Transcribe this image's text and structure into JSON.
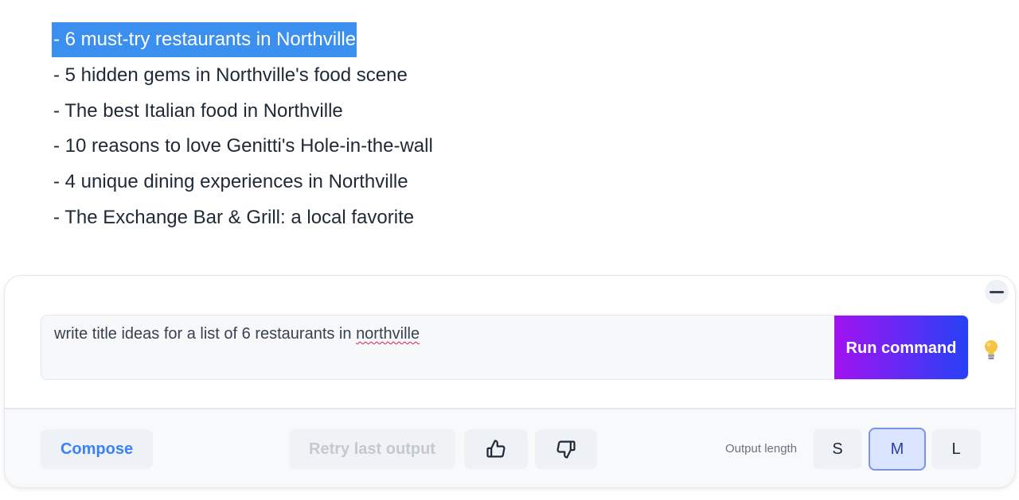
{
  "output": {
    "lines": [
      "- 6 must-try restaurants in Northville",
      "- 5 hidden gems in Northville's food scene",
      "- The best Italian food in Northville",
      "- 10 reasons to love Genitti's Hole-in-the-wall",
      "- 4 unique dining experiences in Northville",
      "- The Exchange Bar & Grill: a local favorite"
    ]
  },
  "command": {
    "prompt_before": "write title ideas for a list of 6 restaurants in ",
    "prompt_misspelled": "northville",
    "run_label": "Run command",
    "hint_icon": "lightbulb-icon"
  },
  "footer": {
    "compose_label": "Compose",
    "retry_label": "Retry last output",
    "thumbs_up_icon": "thumbs-up-icon",
    "thumbs_down_icon": "thumbs-down-icon",
    "output_length_label": "Output length",
    "sizes": [
      "S",
      "M",
      "L"
    ],
    "selected_size": "M"
  },
  "colors": {
    "selection": "#3b8fef",
    "accent": "#3b82f6",
    "run_gradient_start": "#a112f0",
    "run_gradient_end": "#2641f5"
  }
}
